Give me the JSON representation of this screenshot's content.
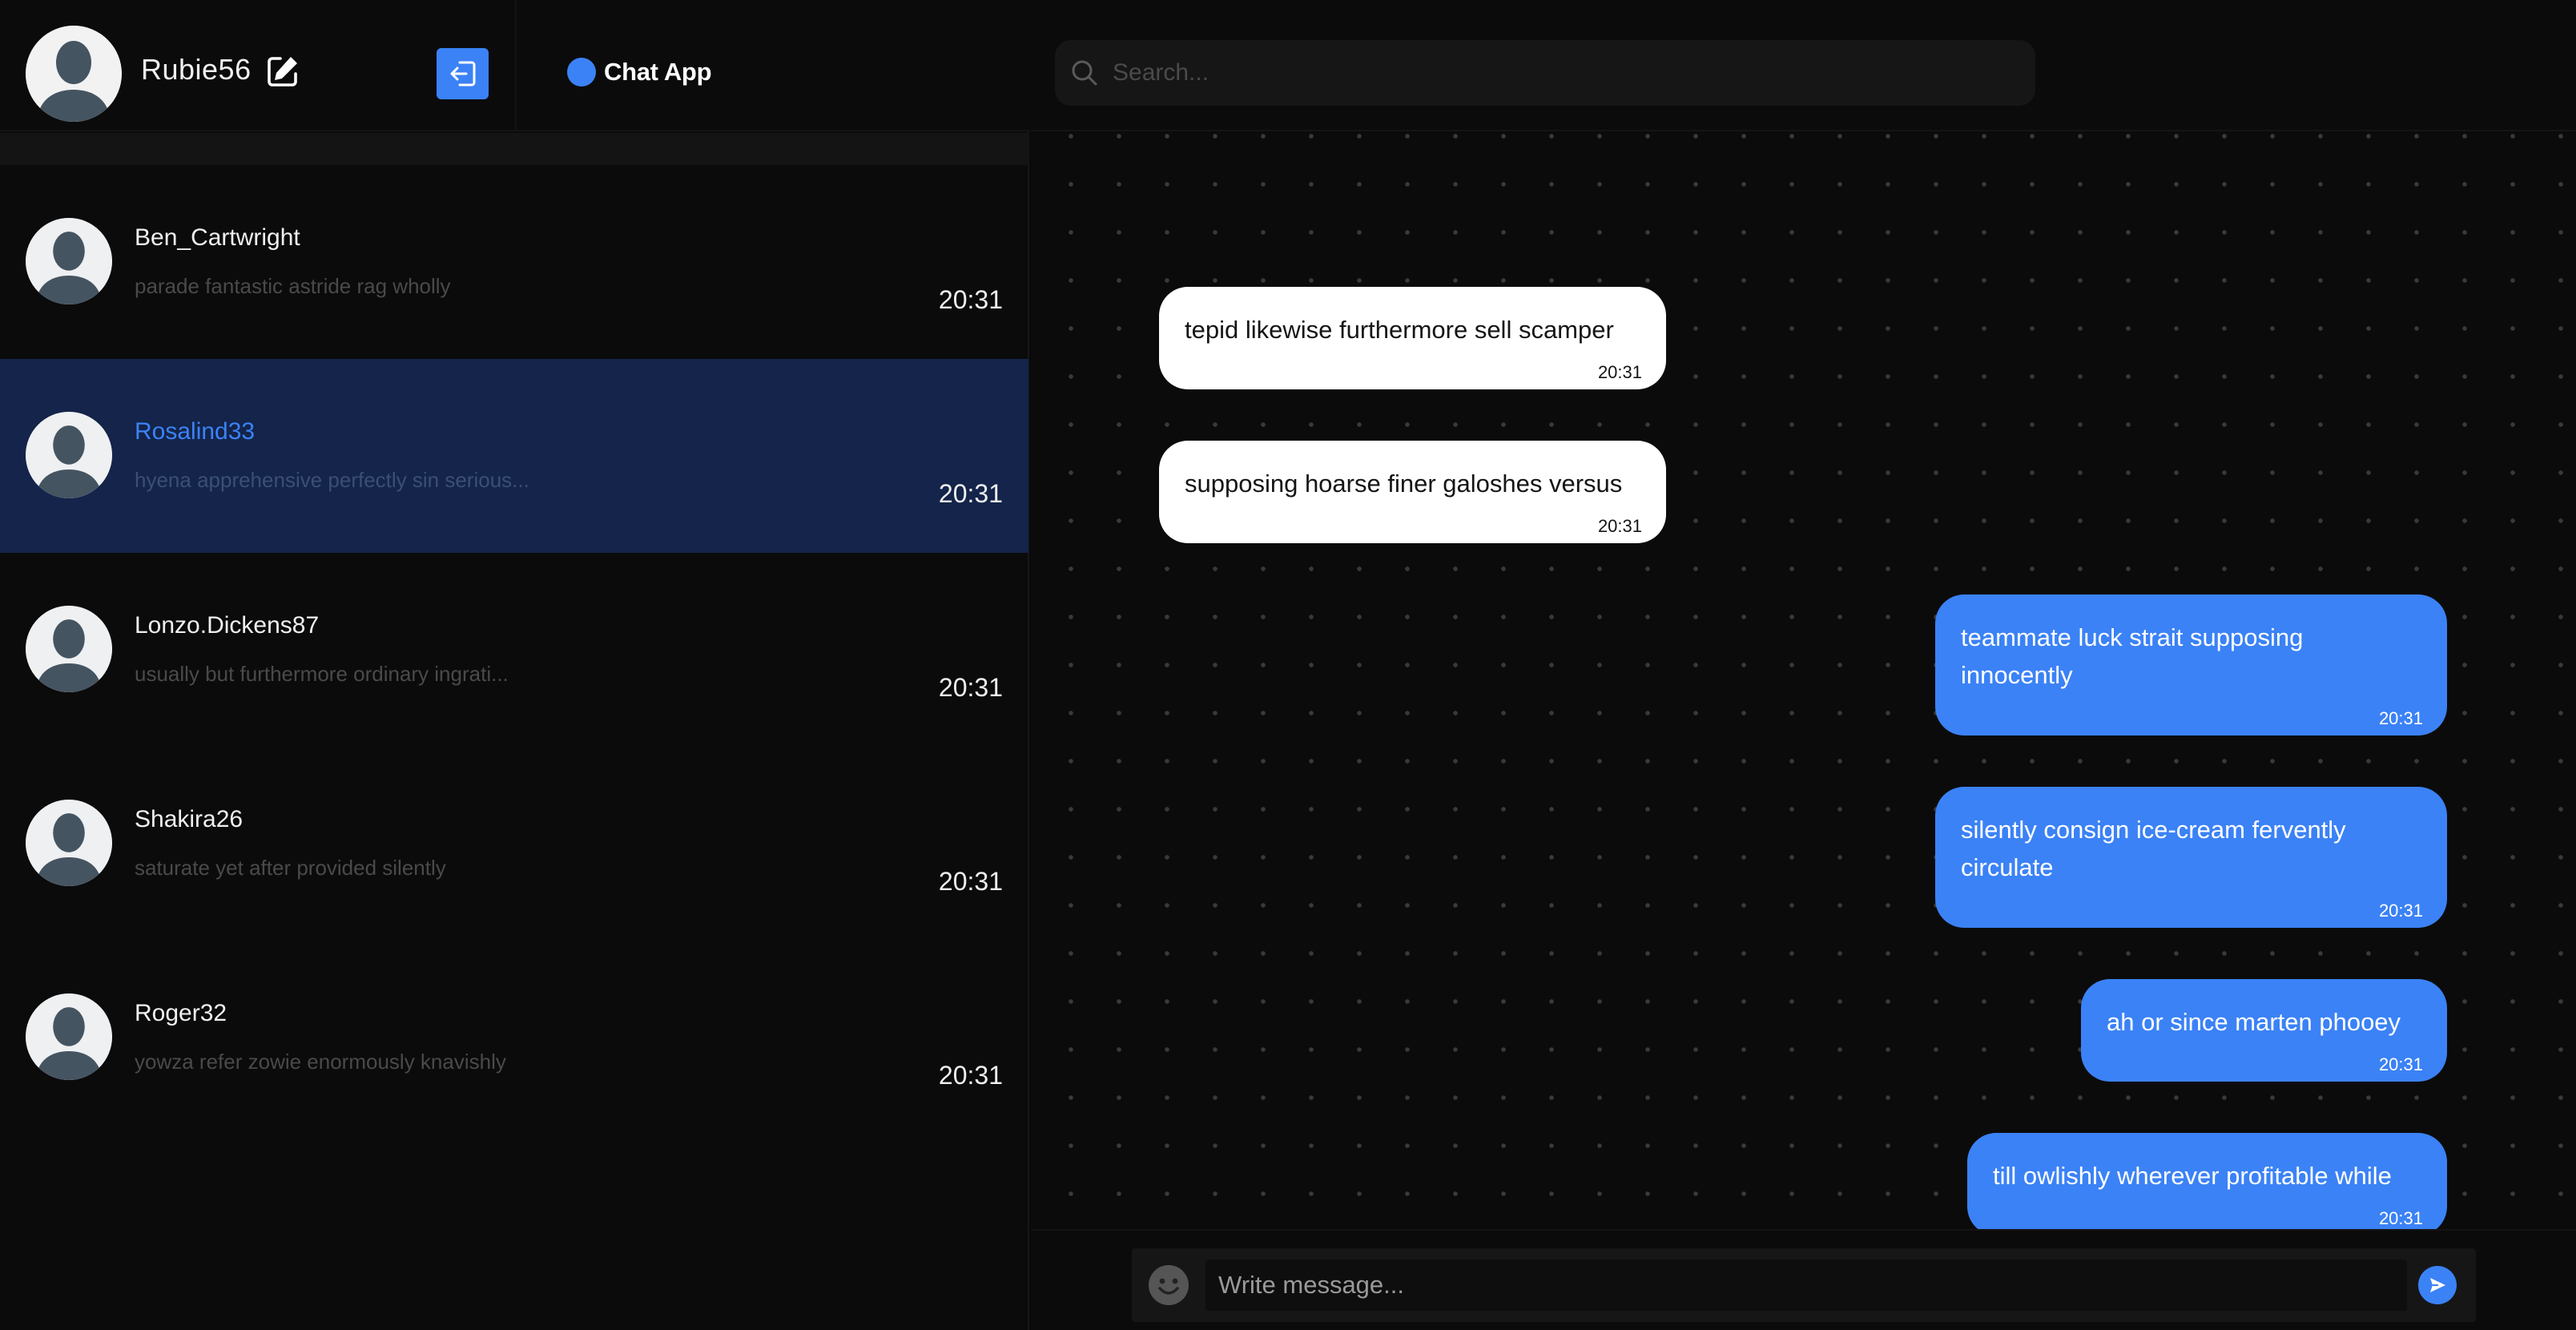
{
  "app": {
    "brand_name": "Chat App",
    "accent_color": "#3b82f6"
  },
  "user": {
    "username": "Rubie56",
    "avatar_icon": "user-silhouette-icon",
    "edit_icon": "edit-icon",
    "logout_icon": "logout-icon"
  },
  "search": {
    "placeholder": "Search...",
    "icon": "search-icon"
  },
  "conversations": [
    {
      "name": "Ben_Cartwright",
      "preview": "parade fantastic astride rag wholly",
      "time": "20:31",
      "active": false
    },
    {
      "name": "Rosalind33",
      "preview": "hyena apprehensive perfectly sin serious...",
      "time": "20:31",
      "active": true
    },
    {
      "name": "Lonzo.Dickens87",
      "preview": "usually but furthermore ordinary ingrati...",
      "time": "20:31",
      "active": false
    },
    {
      "name": "Shakira26",
      "preview": "saturate yet after provided silently",
      "time": "20:31",
      "active": false
    },
    {
      "name": "Roger32",
      "preview": "yowza refer zowie enormously knavishly",
      "time": "20:31",
      "active": false
    }
  ],
  "messages": [
    {
      "direction": "incoming",
      "text": "tepid likewise furthermore sell scamper",
      "time": "20:31"
    },
    {
      "direction": "incoming",
      "text": "supposing hoarse finer galoshes versus",
      "time": "20:31"
    },
    {
      "direction": "outgoing",
      "text": "teammate luck strait supposing innocently",
      "time": "20:31"
    },
    {
      "direction": "outgoing",
      "text": "silently consign ice-cream fervently circulate",
      "time": "20:31"
    },
    {
      "direction": "outgoing",
      "text": "ah or since marten phooey",
      "time": "20:31"
    },
    {
      "direction": "outgoing",
      "text": "till owlishly wherever profitable while",
      "time": "20:31"
    }
  ],
  "composer": {
    "placeholder": "Write message...",
    "emoji_icon": "emoji-icon",
    "send_icon": "send-icon"
  }
}
